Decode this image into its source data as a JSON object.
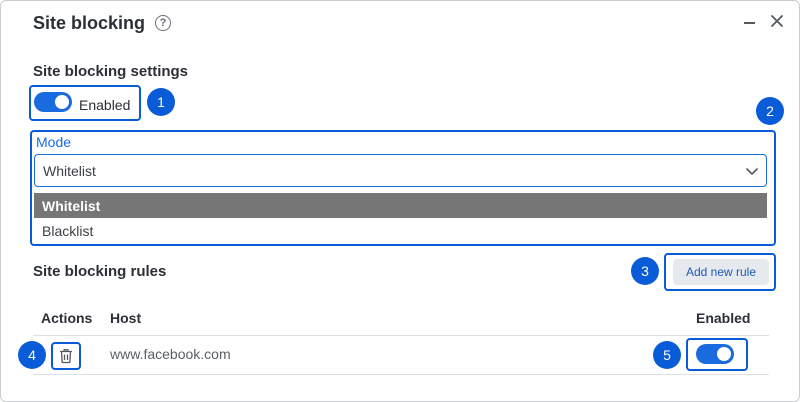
{
  "dialog": {
    "title": "Site blocking",
    "help_icon": "question-circle-icon",
    "help_glyph": "?"
  },
  "settings": {
    "heading": "Site blocking settings",
    "toggle_label": "Enabled",
    "enabled": true
  },
  "mode": {
    "label": "Mode",
    "selected": "Whitelist",
    "options": [
      "Whitelist",
      "Blacklist"
    ],
    "highlighted_option": "Whitelist"
  },
  "rules": {
    "heading": "Site blocking rules",
    "add_button": "Add new rule",
    "columns": {
      "actions": "Actions",
      "host": "Host",
      "enabled": "Enabled"
    },
    "rows": [
      {
        "host": "www.facebook.com",
        "enabled": true,
        "action_icon": "trash-icon"
      }
    ]
  },
  "annotations": [
    "1",
    "2",
    "3",
    "4",
    "5"
  ],
  "colors": {
    "accent": "#0a5bd8",
    "toggle_on": "#1a6be0",
    "selected_option_bg": "#767676"
  }
}
